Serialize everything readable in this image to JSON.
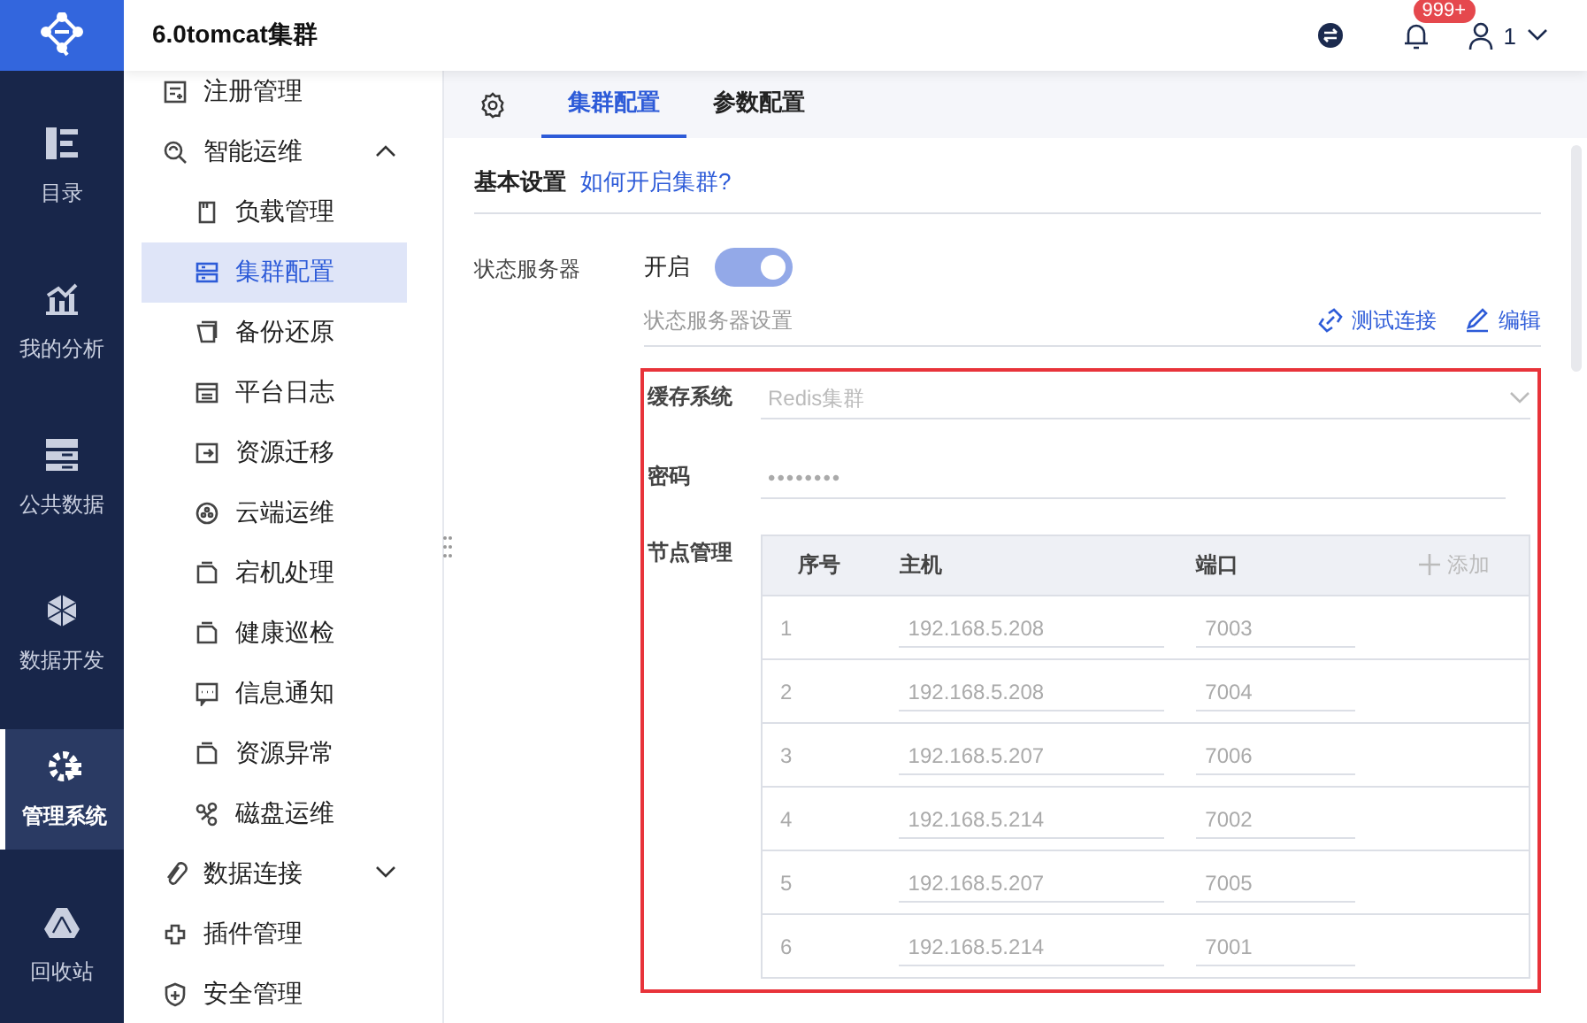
{
  "header": {
    "title": "6.0tomcat集群",
    "notification_badge": "999+",
    "user": "1"
  },
  "rail": [
    {
      "label": "目录",
      "selected": false
    },
    {
      "label": "我的分析",
      "selected": false
    },
    {
      "label": "公共数据",
      "selected": false
    },
    {
      "label": "数据开发",
      "selected": false
    },
    {
      "label": "管理系统",
      "selected": true
    },
    {
      "label": "回收站",
      "selected": false
    }
  ],
  "sidebar": {
    "items": [
      {
        "label": "注册管理",
        "selected": false
      },
      {
        "label": "智能运维",
        "selected": false,
        "expanded": true,
        "children": [
          {
            "label": "负载管理",
            "selected": false
          },
          {
            "label": "集群配置",
            "selected": true
          },
          {
            "label": "备份还原",
            "selected": false
          },
          {
            "label": "平台日志",
            "selected": false
          },
          {
            "label": "资源迁移",
            "selected": false
          },
          {
            "label": "云端运维",
            "selected": false
          },
          {
            "label": "宕机处理",
            "selected": false
          },
          {
            "label": "健康巡检",
            "selected": false
          },
          {
            "label": "信息通知",
            "selected": false
          },
          {
            "label": "资源异常",
            "selected": false
          },
          {
            "label": "磁盘运维",
            "selected": false
          }
        ]
      },
      {
        "label": "数据连接",
        "selected": false,
        "expanded": false
      },
      {
        "label": "插件管理",
        "selected": false
      },
      {
        "label": "安全管理",
        "selected": false
      }
    ]
  },
  "tabs": [
    {
      "label": "集群配置",
      "selected": true
    },
    {
      "label": "参数配置",
      "selected": false
    }
  ],
  "basic_settings": {
    "title": "基本设置",
    "help_link": "如何开启集群?"
  },
  "state_server": {
    "label": "状态服务器",
    "switch_label": "开启",
    "on": true,
    "settings_label": "状态服务器设置",
    "actions": [
      "测试连接",
      "编辑"
    ]
  },
  "cluster_settings": {
    "highlighted": true,
    "cache_system": {
      "label": "缓存系统",
      "value": "Redis集群"
    },
    "password": {
      "label": "密码",
      "value": "••••••••"
    },
    "nodes": {
      "label": "节点管理",
      "columns": [
        "序号",
        "主机",
        "端口"
      ],
      "add_button": "添加",
      "rows": [
        {
          "index": "1",
          "host": "192.168.5.208",
          "port": "7003"
        },
        {
          "index": "2",
          "host": "192.168.5.208",
          "port": "7004"
        },
        {
          "index": "3",
          "host": "192.168.5.207",
          "port": "7006"
        },
        {
          "index": "4",
          "host": "192.168.5.214",
          "port": "7002"
        },
        {
          "index": "5",
          "host": "192.168.5.207",
          "port": "7005"
        },
        {
          "index": "6",
          "host": "192.168.5.214",
          "port": "7001"
        }
      ]
    }
  }
}
